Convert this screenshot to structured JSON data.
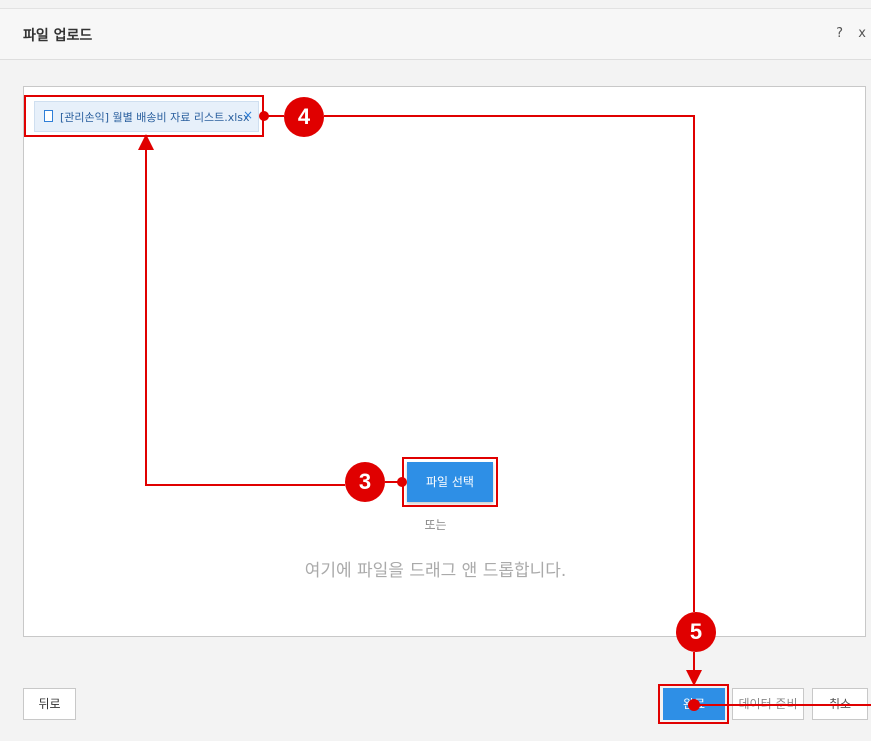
{
  "dialog": {
    "title": "파일 업로드",
    "help_label": "?",
    "close_label": "x"
  },
  "uploaded_file": {
    "name": "[관리손익] 월별 배송비 자료 리스트.xlsx",
    "remove_label": "×"
  },
  "dropzone": {
    "select_button_label": "파일 선택",
    "or_text": "또는",
    "drop_text": "여기에 파일을 드래그 앤 드롭합니다."
  },
  "footer": {
    "back_label": "뒤로",
    "done_label": "완료",
    "prepare_label": "데이터 준비",
    "cancel_label": "취소"
  },
  "annotations": {
    "color": "#e00000",
    "step_3": "3",
    "step_4": "4",
    "step_5": "5"
  },
  "colors": {
    "primary": "#2e8fe6",
    "file_chip_bg": "#e7f0fa"
  }
}
